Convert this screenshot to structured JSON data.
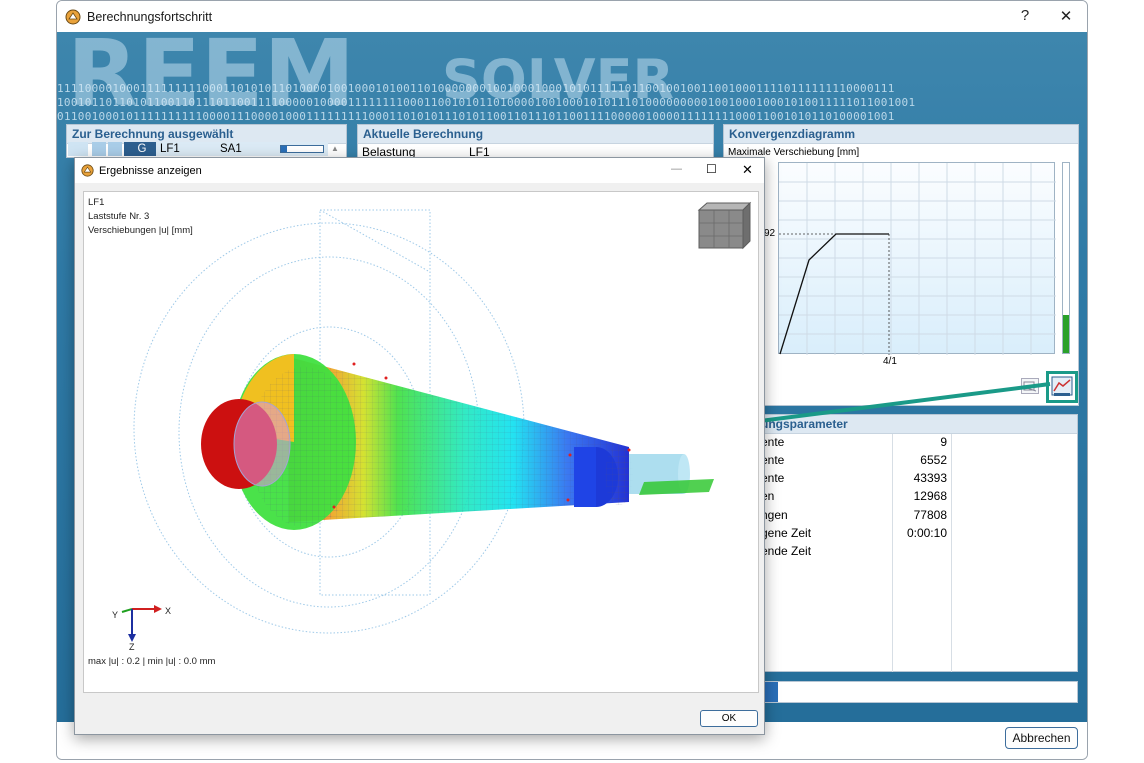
{
  "window": {
    "title": "Berechnungsfortschritt",
    "help": "?",
    "close": "✕"
  },
  "banner": {
    "word1": "REEM",
    "word2": "SOLVER",
    "bin1": "1111000010001111111110001101010110100001001000101001101000000010010001000101011111011001001001100100011110111111110000111",
    "bin2": "1001011011010110011011101100111100000100001111111100011001010110100001001000101011101000000000100100010001010011111011001001",
    "bin3": "0110010001011111111110000111000010001111111110001101010111010110011011101100111100000100001111111100011001010110100001001"
  },
  "left_panel": {
    "title": "Zur Berechnung ausgewählt",
    "row": [
      "G",
      "LF1",
      "SA1"
    ]
  },
  "mid_panel": {
    "title": "Aktuelle Berechnung",
    "row_label": "Belastung",
    "row_value": "LF1"
  },
  "right_panel": {
    "title": "Konvergenzdiagramm",
    "subtitle": "Maximale Verschiebung [mm]",
    "y_tick": "92",
    "x_tick": "4/1",
    "bar_fill": 0.2
  },
  "params": {
    "title": "ungsparameter",
    "rows": [
      {
        "label": "ente",
        "value": "9"
      },
      {
        "label": "ente",
        "value": "6552"
      },
      {
        "label": "ente",
        "value": "43393"
      },
      {
        "label": "en",
        "value": "12968"
      },
      {
        "label": "ngen",
        "value": "77808"
      },
      {
        "label": "gene Zeit",
        "value": "0:00:10"
      },
      {
        "label": "ende Zeit",
        "value": ""
      }
    ]
  },
  "cancel_label": "Abbrechen",
  "results": {
    "title": "Ergebnisse anzeigen",
    "minimize": "—",
    "maximize": "☐",
    "close": "✕",
    "info_line1": "LF1",
    "info_line2": "Laststufe Nr. 3",
    "info_line3": "Verschiebungen |u| [mm]",
    "axis_x": "X",
    "axis_y": "Y",
    "axis_z": "Z",
    "summary": "max |u| : 0.2 | min |u| : 0.0 mm",
    "ok_label": "OK"
  },
  "colors": {
    "accent": "#1a9a88",
    "header": "#2a5f8f",
    "banner": "#2f7aa6"
  }
}
